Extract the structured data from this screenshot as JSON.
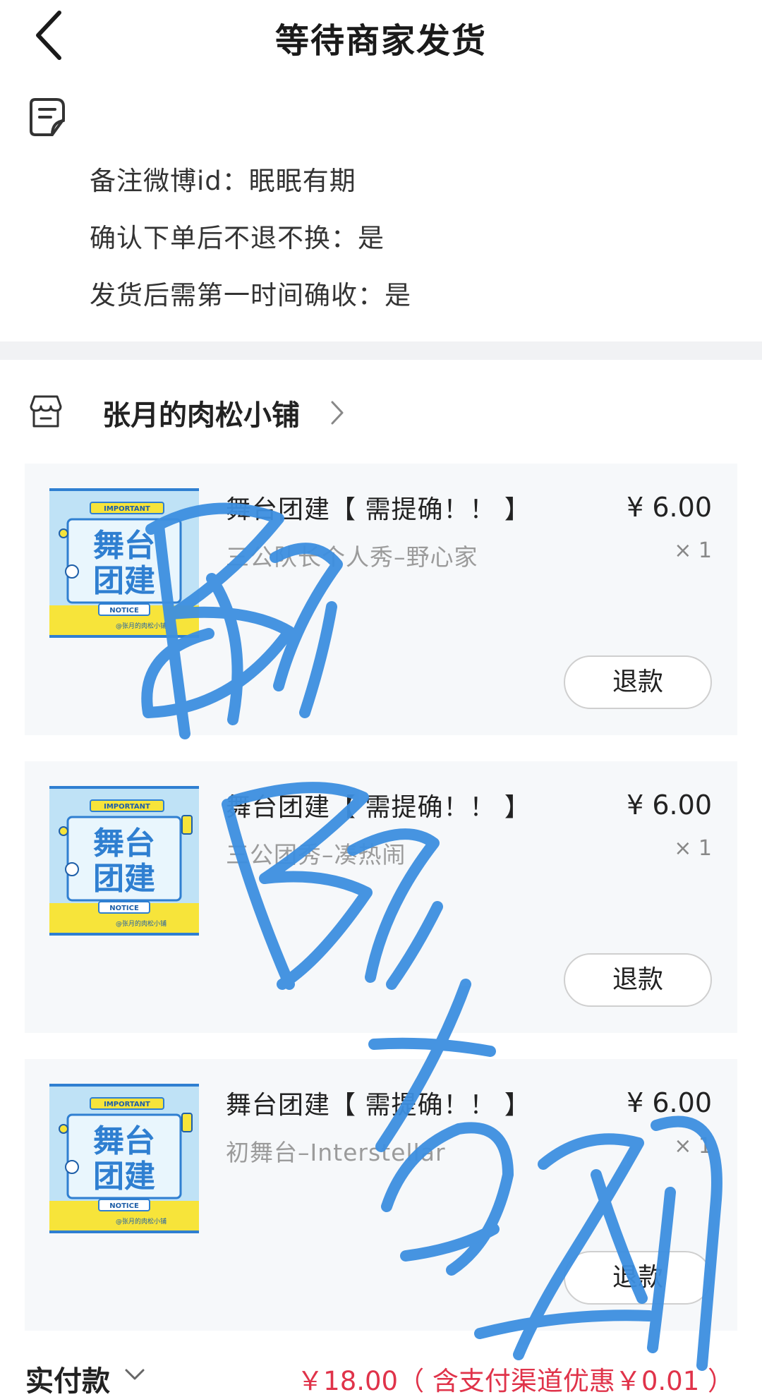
{
  "header": {
    "title": "等待商家发货",
    "back_icon": "back-arrow-icon"
  },
  "memo": {
    "icon": "memo-icon",
    "lines": [
      "备注微博id：眠眠有期",
      "确认下单后不退不换：是",
      "发货后需第一时间确收：是"
    ]
  },
  "shop": {
    "icon": "shop-icon",
    "name": "张月的肉松小铺"
  },
  "items": [
    {
      "name": "舞台团建【 需提确！！ 】",
      "variant": "三公队长个人秀–野心家",
      "price": "¥ 6.00",
      "qty": "× 1",
      "refund_label": "退款",
      "thumb": {
        "top": "IMPORTANT",
        "line1": "舞台",
        "line2": "团建",
        "notice": "NOTICE",
        "shop": "@张月的肉松小铺"
      }
    },
    {
      "name": "舞台团建【 需提确！！ 】",
      "variant": "三公团秀–凑热闹",
      "price": "¥ 6.00",
      "qty": "× 1",
      "refund_label": "退款",
      "thumb": {
        "top": "IMPORTANT",
        "line1": "舞台",
        "line2": "团建",
        "notice": "NOTICE",
        "shop": "@张月的肉松小铺"
      }
    },
    {
      "name": "舞台团建【 需提确！！ 】",
      "variant": "初舞台–Interstellar",
      "price": "¥ 6.00",
      "qty": "× 1",
      "refund_label": "退款",
      "thumb": {
        "top": "IMPORTANT",
        "line1": "舞台",
        "line2": "团建",
        "notice": "NOTICE",
        "shop": "@张月的肉松小铺"
      }
    }
  ],
  "total": {
    "label": "实付款",
    "value": "￥18.00（ 含支付渠道优惠￥0.01 ）"
  },
  "watermark": {
    "text": "眠眠有期",
    "color": "#3d8fe0"
  },
  "colors": {
    "price_red": "#e0334a",
    "card_bg": "#f6f8fa",
    "thumb_blue": "#2f7fd1",
    "thumb_yellow": "#f7e43a"
  }
}
